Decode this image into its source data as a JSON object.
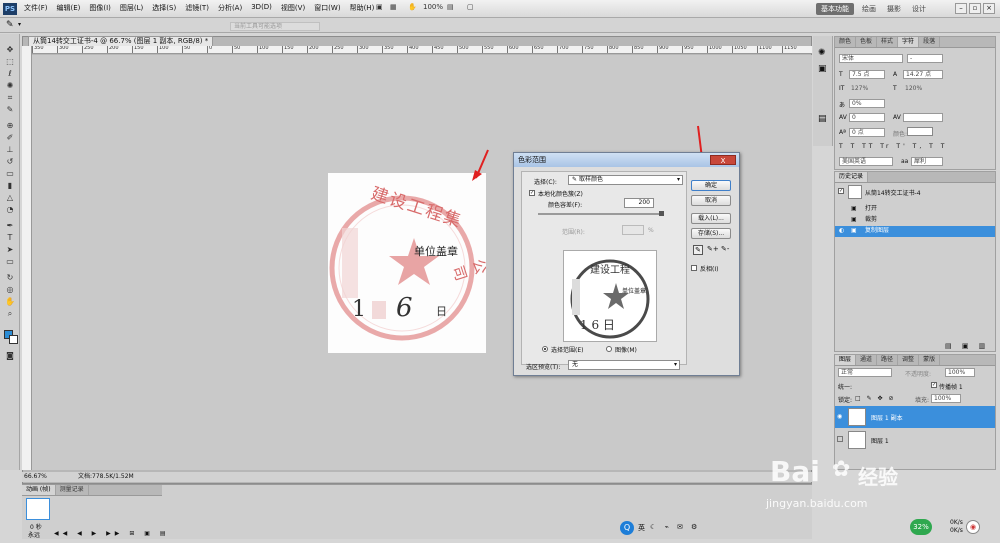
{
  "menubar": {
    "logo": "PS",
    "items": [
      "文件(F)",
      "编辑(E)",
      "图像(I)",
      "图层(L)",
      "选择(S)",
      "滤镜(T)",
      "分析(A)",
      "3D(D)",
      "视图(V)",
      "窗口(W)",
      "帮助(H)"
    ],
    "zoom": "100%",
    "workspace_active": "基本功能",
    "workspaces": [
      "绘画",
      "摄影",
      "设计"
    ]
  },
  "options_bar": {
    "hint": "当前工具可能选项"
  },
  "document": {
    "tab_title": "从筒14转交工证书-4 @ 66.7% (图层 1 副本, RGB/8) *",
    "ruler_ticks": [
      "350",
      "300",
      "250",
      "200",
      "150",
      "100",
      "50",
      "0",
      "50",
      "100",
      "150",
      "200",
      "250",
      "300",
      "350",
      "400",
      "450",
      "500",
      "550",
      "600",
      "650",
      "700",
      "750",
      "800",
      "850",
      "900",
      "950",
      "1000",
      "1050",
      "1100",
      "1150"
    ],
    "zoom_status": "66.67%",
    "doc_size": "文档:778.5K/1.52M"
  },
  "stamp": {
    "arc_text": "建设工程集",
    "right_text": "单位盖章",
    "date_text": "1 6 日",
    "day_char": "日",
    "ink_color": "#e28a8a",
    "arc_side": "公司",
    "date_num": "1",
    "date_num2": "6"
  },
  "dialog": {
    "title": "色彩范围",
    "close": "X",
    "select_label": "选择(C):",
    "select_value": "取样颜色",
    "localized_label": "本地化颜色簇(Z)",
    "fuzziness_label": "颜色容差(F):",
    "fuzziness_value": "200",
    "range_label": "范围(R):",
    "range_unit": "%",
    "radio_selection": "选择范围(E)",
    "radio_image": "图像(M)",
    "preview_label": "选区预览(T):",
    "preview_value": "无",
    "btn_ok": "确定",
    "btn_cancel": "取消",
    "btn_load": "载入(L)...",
    "btn_save": "存储(S)...",
    "invert_label": "反相(I)"
  },
  "char_panel": {
    "tabs": [
      "颜色",
      "色板",
      "样式",
      "字符",
      "段落"
    ],
    "active_tab": "字符",
    "font": "宋体",
    "font_style": "-",
    "size": "7.5 点",
    "leading": "14.27 点",
    "vscale": "127%",
    "hscale": "120%",
    "tracking": "0%",
    "kerning": "0",
    "baseline": "0 点",
    "color_label": "颜色:",
    "language": "美国英语",
    "aa_prefix": "aa",
    "aa": "犀利"
  },
  "history_panel": {
    "tab": "历史记录",
    "snapshot": "从筒14转交工证书-4",
    "items": [
      "打开",
      "裁剪",
      "复制图层"
    ],
    "selected": "复制图层"
  },
  "layers_panel": {
    "tabs": [
      "图层",
      "通道",
      "路径",
      "调整",
      "蒙版"
    ],
    "blend_mode": "正常",
    "opacity_label": "不透明度:",
    "opacity": "100%",
    "lock_label": "锁定:",
    "fill_label": "填充:",
    "fill": "100%",
    "propagate": "传播帧 1",
    "unify": "统一:",
    "layers": [
      "图层 1 副本",
      "图层 1"
    ],
    "selected": "图层 1 副本"
  },
  "animation_panel": {
    "tabs": [
      "动画 (帧)",
      "测量记录"
    ],
    "frame_time": "0 秒",
    "loop": "永远"
  },
  "watermark": {
    "brand": "Bai",
    "brand2": "经验",
    "url": "jingyan.baidu.com"
  },
  "taskbar": {
    "ime": "英",
    "battery": "32%",
    "net1": "0K/s",
    "net2": "0K/s"
  }
}
